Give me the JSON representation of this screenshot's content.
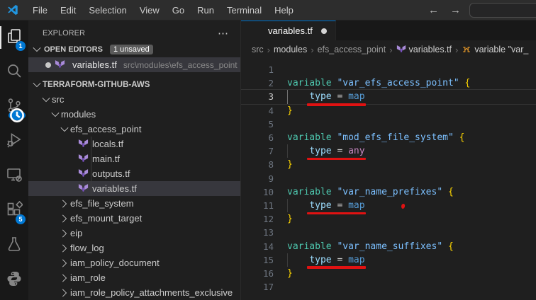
{
  "colors": {
    "accent": "#0078d4",
    "annotation_red": "#e01212",
    "terraform_purple": "#9b77d4"
  },
  "titlebar": {
    "menu_items": [
      "File",
      "Edit",
      "Selection",
      "View",
      "Go",
      "Run",
      "Terminal",
      "Help"
    ],
    "back_arrow": "←",
    "forward_arrow": "→"
  },
  "activity_bar": {
    "items": [
      {
        "name": "explorer",
        "icon": "files-icon",
        "badge": "1",
        "active": true
      },
      {
        "name": "search",
        "icon": "search-icon"
      },
      {
        "name": "source-control",
        "icon": "source-control-icon",
        "badge": "clock"
      },
      {
        "name": "run-debug",
        "icon": "debug-icon"
      },
      {
        "name": "remote-explorer",
        "icon": "remote-icon"
      },
      {
        "name": "extensions",
        "icon": "extensions-icon",
        "badge": "5"
      },
      {
        "name": "testing",
        "icon": "beaker-icon"
      },
      {
        "name": "python",
        "icon": "python-icon"
      }
    ]
  },
  "sidebar": {
    "title": "EXPLORER",
    "more_label": "⋯",
    "open_editors": {
      "label": "OPEN EDITORS",
      "badge": "1 unsaved",
      "items": [
        {
          "label": "variables.tf",
          "path": "src\\modules\\efs_access_point",
          "modified": true,
          "active": true
        }
      ]
    },
    "tree": {
      "root": "TERRAFORM-GITHUB-AWS",
      "items": [
        {
          "label": "src",
          "depth": 1,
          "kind": "folder",
          "expanded": true
        },
        {
          "label": "modules",
          "depth": 2,
          "kind": "folder",
          "expanded": true
        },
        {
          "label": "efs_access_point",
          "depth": 3,
          "kind": "folder",
          "expanded": true
        },
        {
          "label": "locals.tf",
          "depth": 4,
          "kind": "file"
        },
        {
          "label": "main.tf",
          "depth": 4,
          "kind": "file"
        },
        {
          "label": "outputs.tf",
          "depth": 4,
          "kind": "file"
        },
        {
          "label": "variables.tf",
          "depth": 4,
          "kind": "file",
          "selected": true
        },
        {
          "label": "efs_file_system",
          "depth": 3,
          "kind": "folder",
          "expanded": false
        },
        {
          "label": "efs_mount_target",
          "depth": 3,
          "kind": "folder",
          "expanded": false
        },
        {
          "label": "eip",
          "depth": 3,
          "kind": "folder",
          "expanded": false
        },
        {
          "label": "flow_log",
          "depth": 3,
          "kind": "folder",
          "expanded": false
        },
        {
          "label": "iam_policy_document",
          "depth": 3,
          "kind": "folder",
          "expanded": false
        },
        {
          "label": "iam_role",
          "depth": 3,
          "kind": "folder",
          "expanded": false
        },
        {
          "label": "iam_role_policy_attachments_exclusive",
          "depth": 3,
          "kind": "folder",
          "expanded": false
        }
      ]
    }
  },
  "editor": {
    "tab": {
      "label": "variables.tf",
      "modified": true
    },
    "breadcrumbs": [
      {
        "label": "src"
      },
      {
        "label": "modules",
        "emph": true
      },
      {
        "label": "efs_access_point"
      },
      {
        "label": "variables.tf",
        "icon": "terraform-icon",
        "emph": true
      },
      {
        "label": "variable \"var_",
        "icon": "symbol-variable-icon",
        "emph": true
      }
    ],
    "code": {
      "language": "terraform",
      "current_line": 3,
      "lines": [
        {
          "n": 1,
          "tokens": []
        },
        {
          "n": 2,
          "tokens": [
            [
              "variable ",
              "kw"
            ],
            [
              "\"var_efs_access_point\"",
              "str"
            ],
            [
              " ",
              "op"
            ],
            [
              "{",
              "br"
            ]
          ]
        },
        {
          "n": 3,
          "tokens": [
            [
              "    ",
              "op"
            ],
            [
              "type",
              "attr"
            ],
            [
              " = ",
              "op"
            ],
            [
              "map",
              "type"
            ]
          ],
          "guide": true,
          "underline": true
        },
        {
          "n": 4,
          "tokens": [
            [
              "}",
              "br"
            ]
          ]
        },
        {
          "n": 5,
          "tokens": []
        },
        {
          "n": 6,
          "tokens": [
            [
              "variable ",
              "kw"
            ],
            [
              "\"mod_efs_file_system\"",
              "str"
            ],
            [
              " ",
              "op"
            ],
            [
              "{",
              "br"
            ]
          ]
        },
        {
          "n": 7,
          "tokens": [
            [
              "    ",
              "op"
            ],
            [
              "type",
              "attr"
            ],
            [
              " = ",
              "op"
            ],
            [
              "any",
              "kw2"
            ]
          ],
          "guide": true,
          "underline": true
        },
        {
          "n": 8,
          "tokens": [
            [
              "}",
              "br"
            ]
          ]
        },
        {
          "n": 9,
          "tokens": []
        },
        {
          "n": 10,
          "tokens": [
            [
              "variable ",
              "kw"
            ],
            [
              "\"var_name_prefixes\"",
              "str"
            ],
            [
              " ",
              "op"
            ],
            [
              "{",
              "br"
            ]
          ]
        },
        {
          "n": 11,
          "tokens": [
            [
              "    ",
              "op"
            ],
            [
              "type",
              "attr"
            ],
            [
              " = ",
              "op"
            ],
            [
              "map",
              "type"
            ]
          ],
          "guide": true,
          "underline": true,
          "dot": true
        },
        {
          "n": 12,
          "tokens": [
            [
              "}",
              "br"
            ]
          ]
        },
        {
          "n": 13,
          "tokens": []
        },
        {
          "n": 14,
          "tokens": [
            [
              "variable ",
              "kw"
            ],
            [
              "\"var_name_suffixes\"",
              "str"
            ],
            [
              " ",
              "op"
            ],
            [
              "{",
              "br"
            ]
          ]
        },
        {
          "n": 15,
          "tokens": [
            [
              "    ",
              "op"
            ],
            [
              "type",
              "attr"
            ],
            [
              " = ",
              "op"
            ],
            [
              "map",
              "type"
            ]
          ],
          "guide": true,
          "underline": true
        },
        {
          "n": 16,
          "tokens": [
            [
              "}",
              "br"
            ]
          ]
        },
        {
          "n": 17,
          "tokens": []
        }
      ]
    }
  }
}
